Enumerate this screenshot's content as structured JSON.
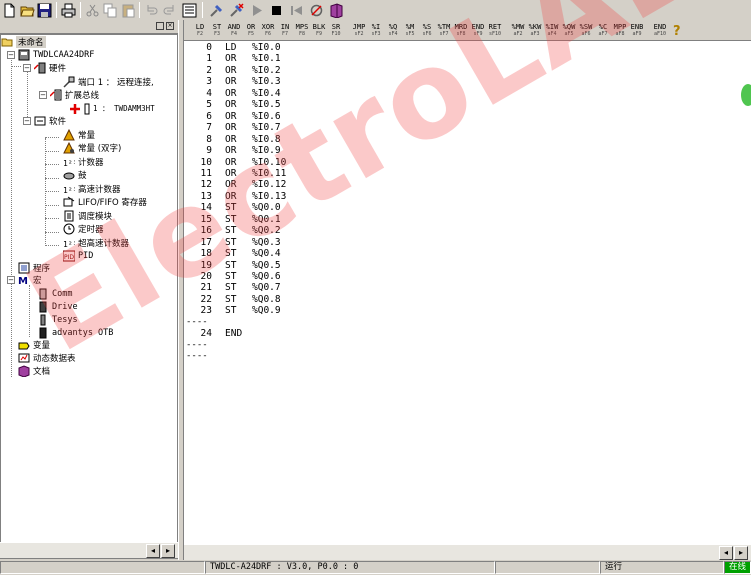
{
  "toolbar": {
    "left_buttons": [
      "new-file-icon",
      "open-folder-icon",
      "save-icon",
      "print-icon",
      "cut-icon",
      "copy-icon",
      "paste-icon",
      "undo-icon",
      "redo-icon"
    ],
    "right_buttons": [
      "list-view-icon",
      "connect-icon",
      "disconnect-icon",
      "run-icon",
      "stop-icon",
      "rewind-icon",
      "sync-icon",
      "book-icon"
    ]
  },
  "instructions": [
    {
      "label": "LD",
      "key": "F2"
    },
    {
      "label": "ST",
      "key": "F3"
    },
    {
      "label": "AND",
      "key": "F4"
    },
    {
      "label": "OR",
      "key": "F5"
    },
    {
      "label": "XOR",
      "key": "F6"
    },
    {
      "label": "IN",
      "key": "F7"
    },
    {
      "label": "MPS",
      "key": "F8"
    },
    {
      "label": "BLK",
      "key": "F9"
    },
    {
      "label": "SR",
      "key": "F10"
    },
    {
      "label": "JMP",
      "key": "sF2"
    },
    {
      "label": "%I",
      "key": "sF3"
    },
    {
      "label": "%Q",
      "key": "sF4"
    },
    {
      "label": "%M",
      "key": "sF5"
    },
    {
      "label": "%S",
      "key": "sF6"
    },
    {
      "label": "%TM",
      "key": "sF7"
    },
    {
      "label": "MRD",
      "key": "sF8"
    },
    {
      "label": "END",
      "key": "sF9"
    },
    {
      "label": "RET",
      "key": "sF10"
    },
    {
      "label": "%MW",
      "key": "aF2"
    },
    {
      "label": "%KW",
      "key": "aF3"
    },
    {
      "label": "%IW",
      "key": "aF4"
    },
    {
      "label": "%QW",
      "key": "aF5"
    },
    {
      "label": "%SW",
      "key": "aF6"
    },
    {
      "label": "%C",
      "key": "aF7"
    },
    {
      "label": "MPP",
      "key": "aF8"
    },
    {
      "label": "ENB",
      "key": "aF9"
    },
    {
      "label": "END",
      "key": "aF10"
    }
  ],
  "tree": {
    "header": "未命名",
    "controller": "TWDLCAA24DRF",
    "hardware": "硬件",
    "port": "端口 1 ： 远程连接,",
    "expansion_bus": "扩展总线",
    "expansion_module": "1 ： TWDAMM3HT",
    "software": "软件",
    "constants": "常量",
    "double_constants": "常量 (双字)",
    "counters": "计数器",
    "drums": "鼓",
    "fast_counters": "高速计数器",
    "lifo_fifo": "LIFO/FIFO 寄存器",
    "pwm": "调度模块",
    "timers": "定时器",
    "very_fast_counters": "超高速计数器",
    "pid": "PID",
    "program": "程序",
    "macros": "宏",
    "macro_comm": "Comm",
    "macro_drive": "Drive",
    "macro_tesys": "Tesys",
    "macro_otb": "advantys OTB",
    "symbols": "变量",
    "animation_table": "动态数据表",
    "documentation": "文档"
  },
  "program": {
    "rung1": [
      {
        "n": "0",
        "op": "LD",
        "arg": "%I0.0"
      },
      {
        "n": "1",
        "op": "OR",
        "arg": "%I0.1"
      },
      {
        "n": "2",
        "op": "OR",
        "arg": "%I0.2"
      },
      {
        "n": "3",
        "op": "OR",
        "arg": "%I0.3"
      },
      {
        "n": "4",
        "op": "OR",
        "arg": "%I0.4"
      },
      {
        "n": "5",
        "op": "OR",
        "arg": "%I0.5"
      },
      {
        "n": "6",
        "op": "OR",
        "arg": "%I0.6"
      },
      {
        "n": "7",
        "op": "OR",
        "arg": "%I0.7"
      },
      {
        "n": "8",
        "op": "OR",
        "arg": "%I0.8"
      },
      {
        "n": "9",
        "op": "OR",
        "arg": "%I0.9"
      },
      {
        "n": "10",
        "op": "OR",
        "arg": "%I0.10"
      },
      {
        "n": "11",
        "op": "OR",
        "arg": "%I0.11"
      },
      {
        "n": "12",
        "op": "OR",
        "arg": "%I0.12"
      },
      {
        "n": "13",
        "op": "OR",
        "arg": "%I0.13"
      },
      {
        "n": "14",
        "op": "ST",
        "arg": "%Q0.0"
      },
      {
        "n": "15",
        "op": "ST",
        "arg": "%Q0.1"
      },
      {
        "n": "16",
        "op": "ST",
        "arg": "%Q0.2"
      },
      {
        "n": "17",
        "op": "ST",
        "arg": "%Q0.3"
      },
      {
        "n": "18",
        "op": "ST",
        "arg": "%Q0.4"
      },
      {
        "n": "19",
        "op": "ST",
        "arg": "%Q0.5"
      },
      {
        "n": "20",
        "op": "ST",
        "arg": "%Q0.6"
      },
      {
        "n": "21",
        "op": "ST",
        "arg": "%Q0.7"
      },
      {
        "n": "22",
        "op": "ST",
        "arg": "%Q0.8"
      },
      {
        "n": "23",
        "op": "ST",
        "arg": "%Q0.9"
      }
    ],
    "separator": "----",
    "rung2": [
      {
        "n": "24",
        "op": "END",
        "arg": ""
      }
    ]
  },
  "statusbar": {
    "controller_info": "TWDLC-A24DRF : V3.0, P0.0 : 0",
    "state": "运行",
    "connection": "在线"
  },
  "watermark": "ElectroLAB",
  "colors": {
    "online": "#00a000",
    "watermark": "#f03c3c"
  }
}
